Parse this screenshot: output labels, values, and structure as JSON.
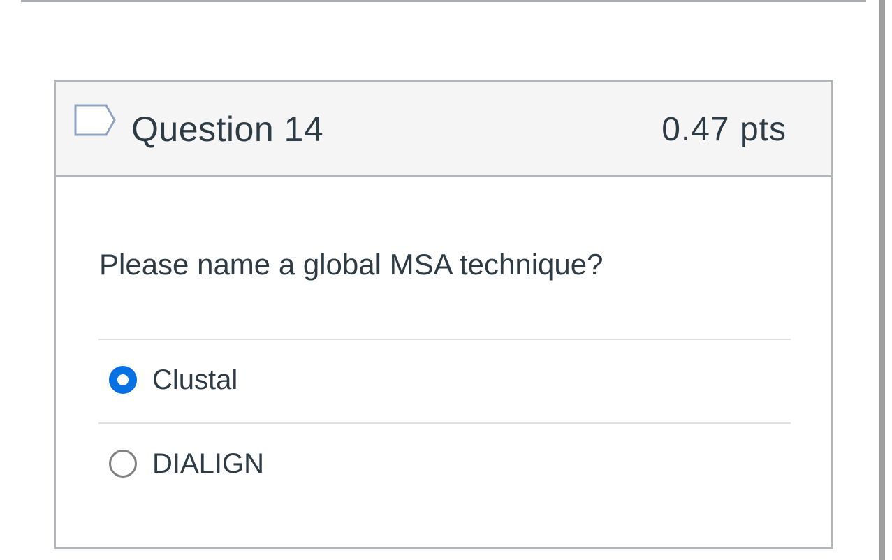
{
  "question": {
    "title": "Question 14",
    "points": "0.47 pts",
    "flag_icon": "flag-outline-icon",
    "text": "Please name a global MSA technique?",
    "answers": [
      {
        "label": "Clustal",
        "selected": true
      },
      {
        "label": "DIALIGN",
        "selected": false
      }
    ]
  },
  "colors": {
    "accent": "#0770e3",
    "text": "#2d3b45",
    "header_bg": "#f5f5f5",
    "border": "#b2b5b8"
  }
}
